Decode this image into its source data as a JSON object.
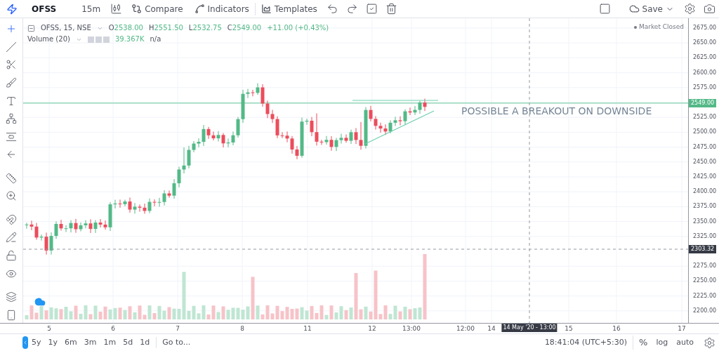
{
  "toolbar": {
    "symbol": "OFSS",
    "interval": "15m",
    "compare": "Compare",
    "indicators": "Indicators",
    "templates": "Templates",
    "save": "Save"
  },
  "legend": {
    "series": "OFSS, 15, NSE",
    "ohlc": [
      {
        "label": "O",
        "value": "2538.00"
      },
      {
        "label": "H",
        "value": "2551.50"
      },
      {
        "label": "L",
        "value": "2532.75"
      },
      {
        "label": "C",
        "value": "2549.00"
      }
    ],
    "change": "+11.00 (+0.43%)",
    "volume_label": "Volume (20)",
    "volume_value": "39.367K",
    "volume_ma": "n/a"
  },
  "market_status": "Market Closed",
  "annotation": "POSSIBLE A BREAKOUT ON DOWNSIDE",
  "price_axis": {
    "ticks": [
      "2675.00",
      "2650.00",
      "2625.00",
      "2600.00",
      "2575.00",
      "2525.00",
      "2500.00",
      "2475.00",
      "2450.00",
      "2425.00",
      "2400.00",
      "2375.00",
      "2350.00",
      "2325.00",
      "2275.00",
      "2250.00",
      "2225.00",
      "2200.00"
    ],
    "last_price": "2549.00",
    "crosshair_price": "2303.32"
  },
  "time_axis": {
    "ticks": [
      "5",
      "6",
      "7",
      "8",
      "11",
      "12",
      "13:00",
      "12:00",
      "14",
      "15",
      "16",
      "17"
    ],
    "crosshair_time": "14 May '20 - 13:00"
  },
  "bottom_bar": {
    "ranges": [
      "5y",
      "1y",
      "6m",
      "3m",
      "1m",
      "5d",
      "1d"
    ],
    "goto": "Go to...",
    "clock": "18:41:04 (UTC+5:30)",
    "percent": "%",
    "log": "log",
    "auto": "auto"
  }
}
